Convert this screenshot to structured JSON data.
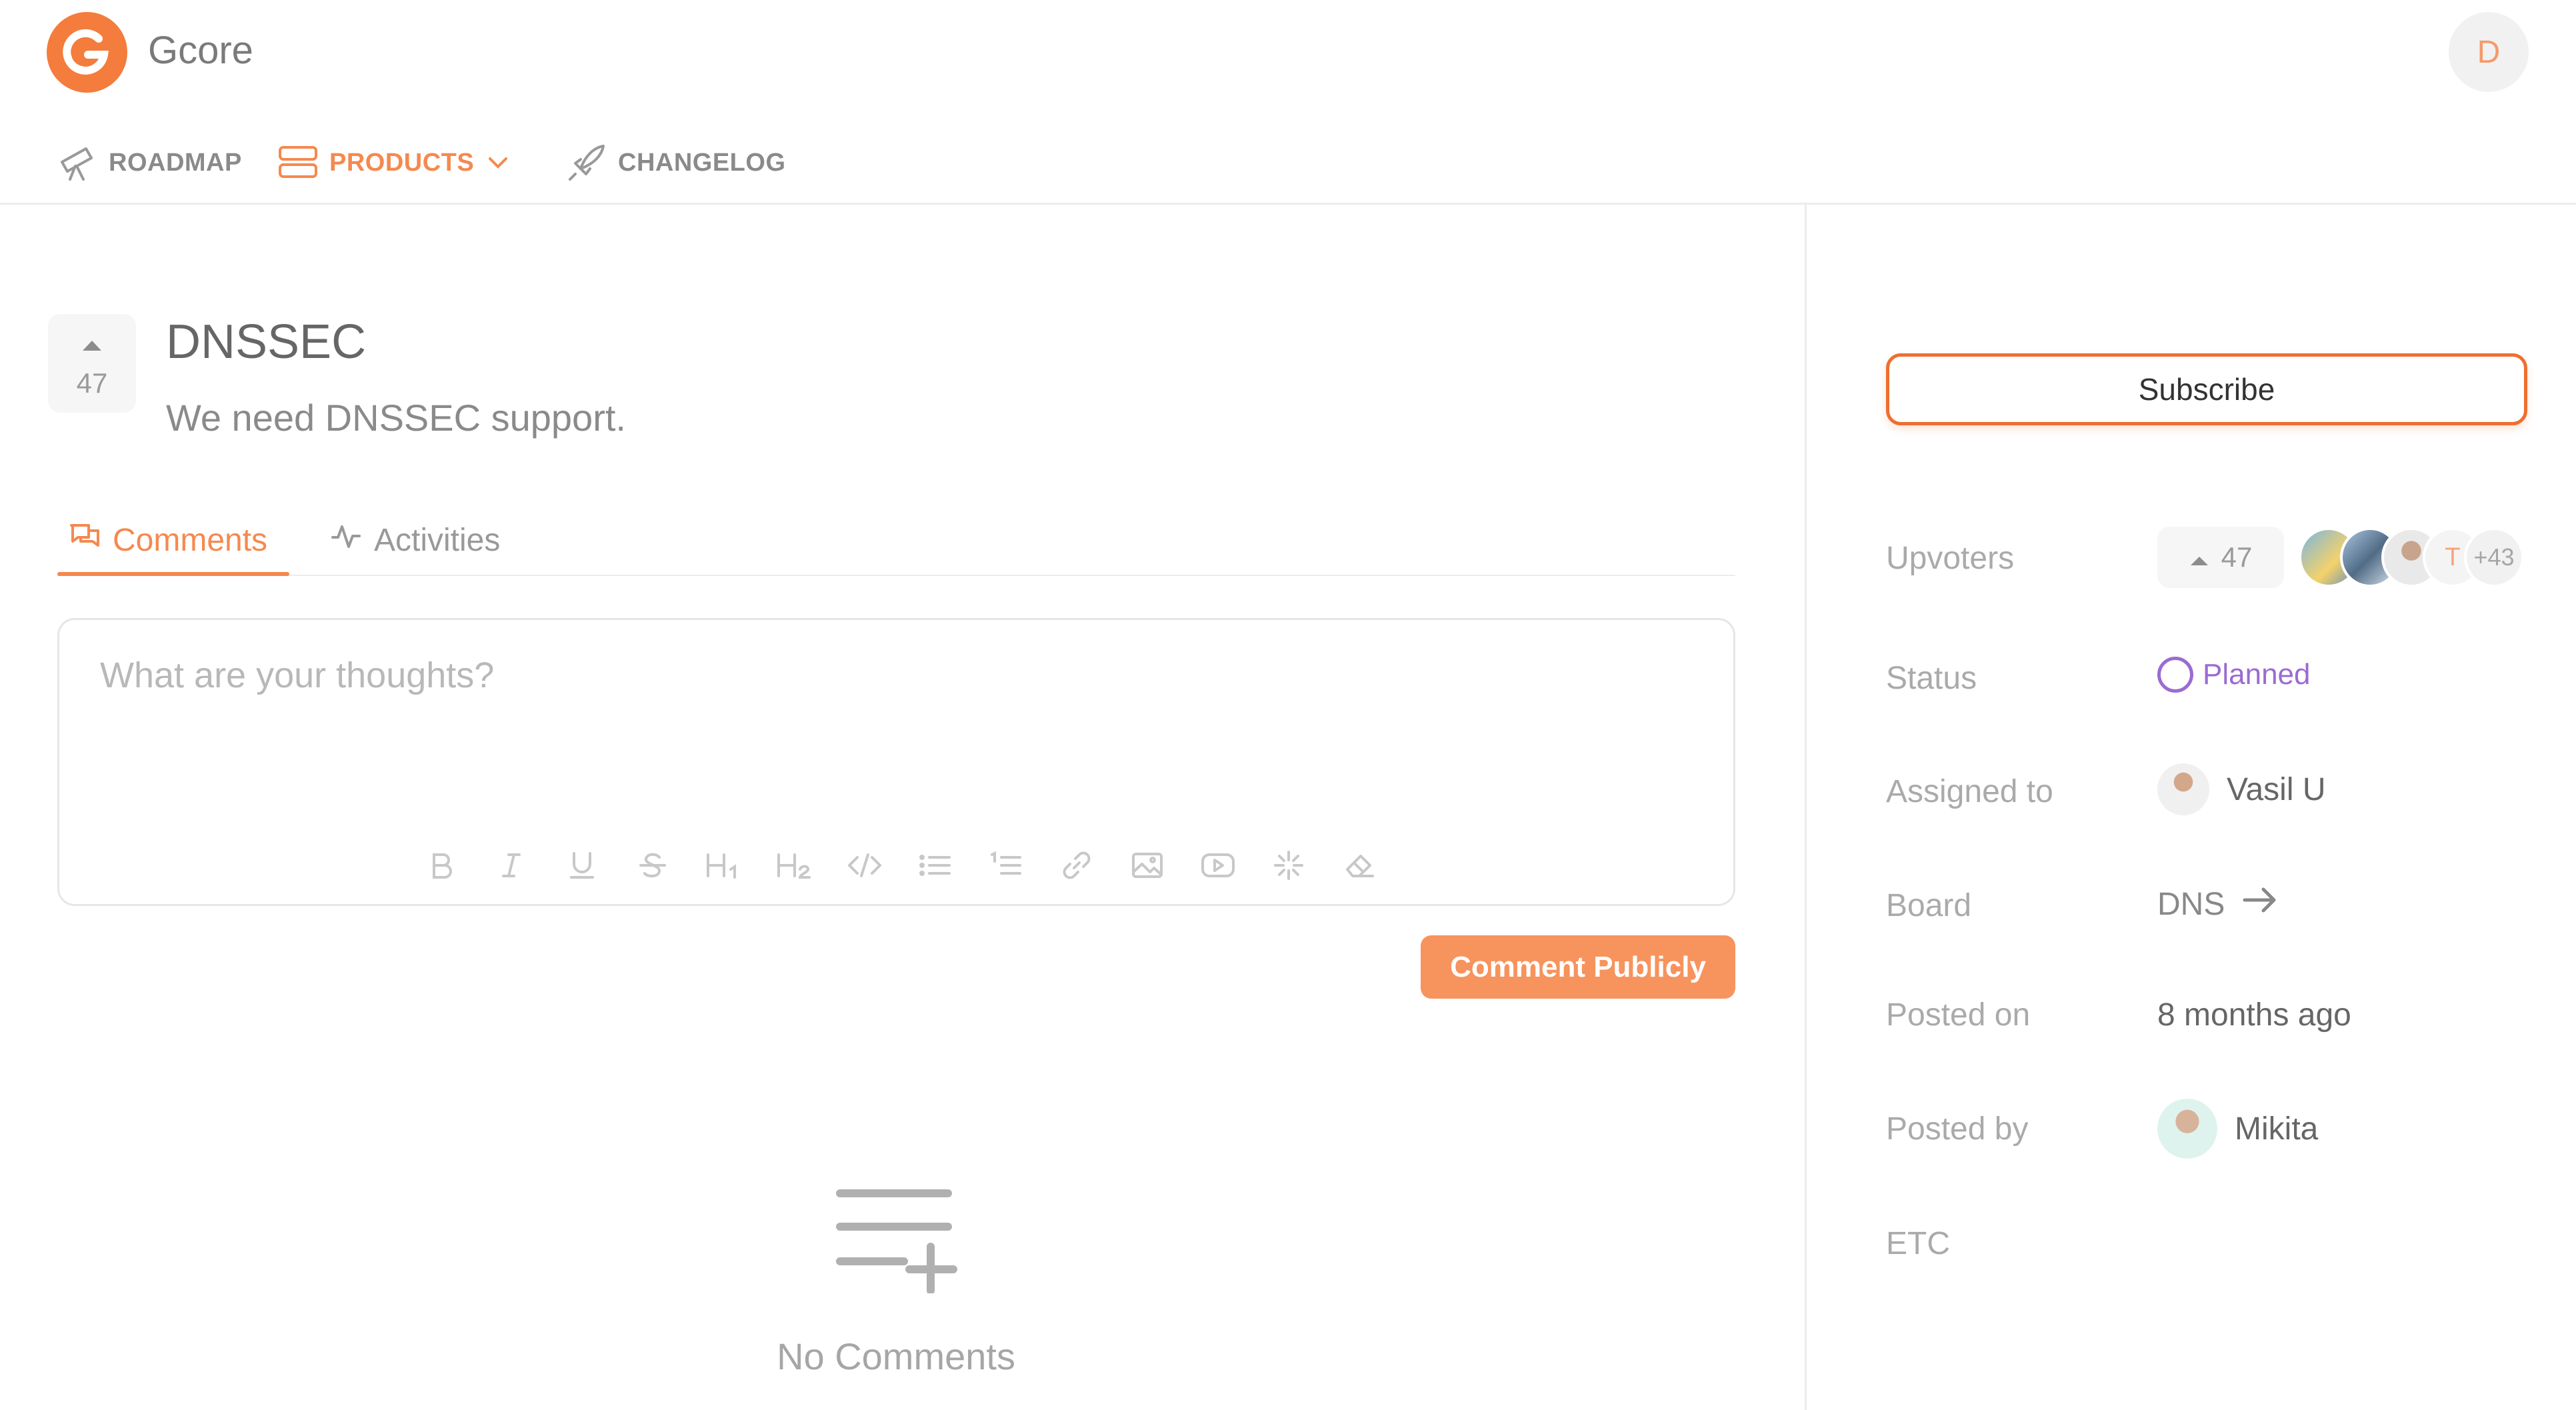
{
  "header": {
    "brand": "Gcore",
    "user_initial": "D",
    "nav": [
      {
        "label": "ROADMAP",
        "icon": "telescope-icon"
      },
      {
        "label": "PRODUCTS",
        "icon": "stack-icon"
      },
      {
        "label": "CHANGELOG",
        "icon": "rocket-icon"
      }
    ]
  },
  "post": {
    "title": "DNSSEC",
    "body": "We need DNSSEC support.",
    "votes": "47"
  },
  "tabs": [
    {
      "label": "Comments",
      "icon": "chat-icon"
    },
    {
      "label": "Activities",
      "icon": "activity-icon"
    }
  ],
  "editor": {
    "placeholder": "What are your thoughts?",
    "toolbar": [
      "bold-icon",
      "italic-icon",
      "underline-icon",
      "strikethrough-icon",
      "heading1-icon",
      "heading2-icon",
      "code-icon",
      "bulleted-list-icon",
      "numbered-list-icon",
      "link-icon",
      "image-icon",
      "video-icon",
      "sparkle-icon",
      "eraser-icon"
    ],
    "submit_label": "Comment Publicly"
  },
  "empty_state": {
    "text": "No Comments"
  },
  "sidebar": {
    "subscribe_label": "Subscribe",
    "upvoters_label": "Upvoters",
    "upvoters_count": "47",
    "upvoters_initial": "T",
    "upvoters_more": "+43",
    "status_label": "Status",
    "status_value": "Planned",
    "assigned_label": "Assigned to",
    "assigned_value": "Vasil U",
    "board_label": "Board",
    "board_value": "DNS",
    "posted_on_label": "Posted on",
    "posted_on_value": "8 months ago",
    "posted_by_label": "Posted by",
    "posted_by_value": "Mikita",
    "etc_label": "ETC"
  },
  "colors": {
    "accent": "#f5894f",
    "status_planned": "#9b6bd1",
    "subscribe_border": "#ef6e2f"
  }
}
